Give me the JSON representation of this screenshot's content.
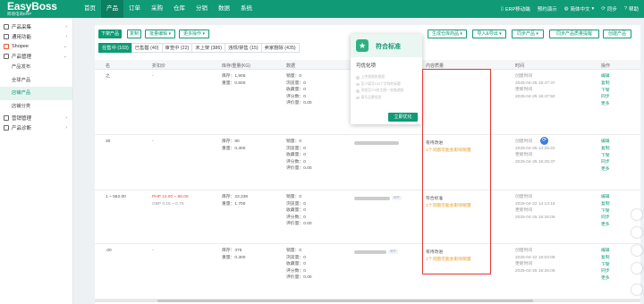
{
  "app": {
    "logo": "EasyBoss",
    "logo_sub": "跨境电商ERP"
  },
  "nav": [
    "首页",
    "产品",
    "订单",
    "采购",
    "仓库",
    "分销",
    "数据",
    "系统"
  ],
  "top_right": {
    "erp_mobile": "ERP移动端",
    "promo": "预约演示",
    "lang": "简体中文",
    "sync": "同步",
    "help": "帮助"
  },
  "sidebar": {
    "groups": [
      {
        "label": "产品采集",
        "expanded": false
      },
      {
        "label": "通用功能",
        "expanded": false
      },
      {
        "label": "Shopee",
        "expanded": true,
        "items": [
          "产品管理"
        ]
      },
      {
        "label": "产品管理",
        "expanded": true,
        "items": [
          "产品发布",
          "全球产品",
          "店铺产品",
          "店铺分类"
        ]
      },
      {
        "label": "营销管理",
        "expanded": false
      },
      {
        "label": "产品诊断",
        "expanded": false
      }
    ],
    "active_item": "店铺产品"
  },
  "toolbar": {
    "publish": "下架产品",
    "copy": "复制",
    "bulk_edit": "批量编辑",
    "more": "更多操作",
    "sync_warehouse": "生成仓库商品",
    "import_export": "导入&导出",
    "sync_product": "同步产品",
    "sync_quality": "同步产品质量提醒",
    "create_product": "创建产品"
  },
  "tabs": [
    "在售中 (103)",
    "已售罄 (40)",
    "审查中 (22)",
    "未上架 (386)",
    "违规/禁售 (15)",
    "卖家删除 (435)"
  ],
  "columns": [
    "名",
    "折扣价",
    "库存/重量(KG)",
    "数据",
    "",
    "内容质量",
    "时间",
    "操作"
  ],
  "rows": [
    {
      "name_frag": "之",
      "discount": "-",
      "stock": "库存：1,905",
      "weight": "重量：0.500",
      "data": [
        "销量：0",
        "浏览量：0",
        "收藏量：0",
        "评分数：0",
        "评价量：0.00"
      ],
      "quality_status": "",
      "quality_tip": "",
      "created": "",
      "updated": "",
      "time1": "2025-04-25 16:47:47",
      "time2": "2025-04-25 16:47:50",
      "time_labels": [
        "创建时间",
        "更新时间"
      ]
    },
    {
      "name_frag": "30",
      "discount": "-",
      "stock": "库存：80",
      "weight": "重量：0.300",
      "data": [
        "销量：0",
        "浏览量：0",
        "收藏量：0",
        "评分数：0",
        "评价量：0.00"
      ],
      "quality_status": "有待改进",
      "quality_tip": "1个问题可能会影响销量",
      "time_labels": [
        "创建时间",
        "更新时间"
      ],
      "time1": "2025-04-25 14:25:22",
      "time2": "2025-04-25 16:25:37"
    },
    {
      "name_frag": "1 ~ 552.00",
      "discount": "PHP 12.00 ~ 56.00",
      "discount2": "GBP 0.16 ~ 0.75",
      "stock": "库存：23,338",
      "weight": "重量：1.700",
      "data": [
        "销量：0",
        "浏览量：0",
        "收藏量：0",
        "评分数：0",
        "评价量：0.00"
      ],
      "quality_status": "符合标准",
      "quality_tip": "1个问题可能会影响销量",
      "time_labels": [
        "创建时间",
        "更新时间"
      ],
      "time1": "2025-04-22 14:13:18",
      "time2": "2025-04-25 16:26:06"
    },
    {
      "name_frag": ".00",
      "discount": "-",
      "stock": "库存：375",
      "weight": "重量：0.300",
      "data": [
        "销量：0",
        "浏览量：0",
        "收藏量：0",
        "评分数：0",
        "评价量：0.00"
      ],
      "quality_status": "有待改进",
      "quality_tip": "1个问题可能会影响销量",
      "time_labels": [
        "创建时间",
        "更新时间"
      ],
      "time1": "2025-04-22 16:04:08",
      "time2": "2025-04-25 16:26:06"
    }
  ],
  "pill_label": "SPF",
  "ops": [
    "编辑",
    "复制",
    "下架",
    "同步",
    "更多"
  ],
  "popup": {
    "title": "符合标准",
    "subtitle": "可优化项",
    "items": [
      "上传视频的视频",
      "至少填写100个字符的标题",
      "添加至少5张主图一张描述图",
      "填写品牌信息"
    ],
    "button": "立即优化"
  },
  "colors": {
    "brand": "#109a76",
    "warn": "#e89b22",
    "red": "#e64b3c"
  }
}
